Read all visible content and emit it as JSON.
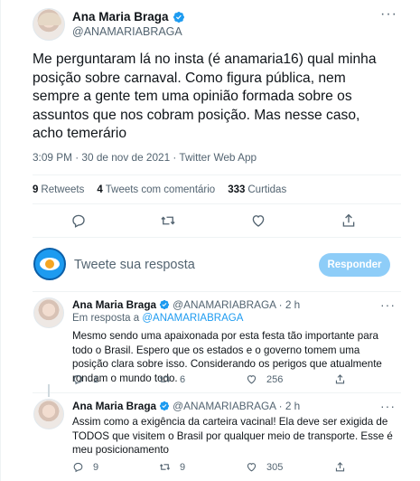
{
  "tweet": {
    "author": {
      "name": "Ana Maria Braga",
      "handle": "@ANAMARIABRAGA"
    },
    "text": "Me perguntaram lá no insta (é anamaria16) qual minha posição sobre carnaval. Como figura pública, nem sempre a gente tem uma opinião formada sobre os assuntos que nos cobram posição. Mas nesse caso, acho temerário",
    "timestamp": "3:09 PM · 30 de nov de 2021 · Twitter Web App",
    "stats": {
      "retweets_count": "9",
      "retweets_label": "Retweets",
      "quotes_count": "4",
      "quotes_label": "Tweets com comentário",
      "likes_count": "333",
      "likes_label": "Curtidas"
    },
    "icons": [
      "reply-icon",
      "retweet-icon",
      "like-icon",
      "share-icon"
    ]
  },
  "compose": {
    "placeholder": "Tweete sua resposta",
    "button_label": "Responder"
  },
  "replies": [
    {
      "name": "Ana Maria Braga",
      "handle": "@ANAMARIABRAGA · 2 h",
      "replying_prefix": "Em resposta a",
      "replying_to": "@ANAMARIABRAGA",
      "text": "Mesmo sendo uma apaixonada por esta festa tão importante para todo o Brasil. Espero que os estados e o governo tomem uma posição clara sobre isso. Considerando os perigos que atualmente rondam o mundo todo.",
      "reply_count": "1",
      "retweet_count": "6",
      "like_count": "256"
    },
    {
      "name": "Ana Maria Braga",
      "handle": "@ANAMARIABRAGA · 2 h",
      "text": "Assim como a exigência da carteira vacinal! Ela deve ser exigida de TODOS que visitem o Brasil por qualquer meio de transporte. Esse é meu posicionamento",
      "reply_count": "9",
      "retweet_count": "9",
      "like_count": "305"
    }
  ],
  "colors": {
    "accent": "#1d9bf0",
    "muted": "#536471",
    "button_disabled": "#8ecdf8"
  }
}
